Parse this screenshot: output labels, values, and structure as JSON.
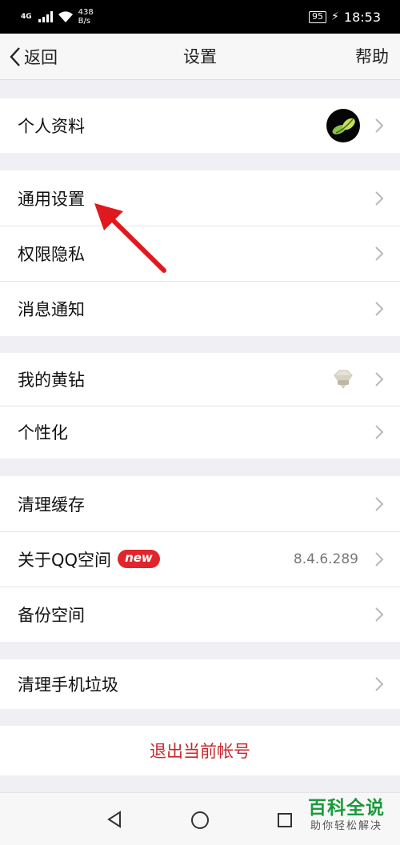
{
  "status_bar": {
    "network": "4G",
    "speed_value": "438",
    "speed_unit": "B/s",
    "battery": "95",
    "time": "18:53"
  },
  "header": {
    "back_label": "返回",
    "title": "设置",
    "help_label": "帮助"
  },
  "groups": {
    "profile": {
      "label": "个人资料"
    },
    "general": {
      "label": "通用设置"
    },
    "privacy": {
      "label": "权限隐私"
    },
    "notify": {
      "label": "消息通知"
    },
    "yellow_diamond": {
      "label": "我的黄钻"
    },
    "personalize": {
      "label": "个性化"
    },
    "clear_cache": {
      "label": "清理缓存"
    },
    "about": {
      "label": "关于QQ空间",
      "badge": "new",
      "version": "8.4.6.289"
    },
    "backup": {
      "label": "备份空间"
    },
    "clean_phone": {
      "label": "清理手机垃圾"
    }
  },
  "logout": {
    "label": "退出当前帐号"
  },
  "watermark": {
    "title": "百科全说",
    "subtitle": "助你轻松解决"
  },
  "colors": {
    "accent_red": "#c4282c",
    "badge_red": "#e1252c",
    "background": "#efeff4",
    "watermark_green": "#1c9a3c"
  }
}
